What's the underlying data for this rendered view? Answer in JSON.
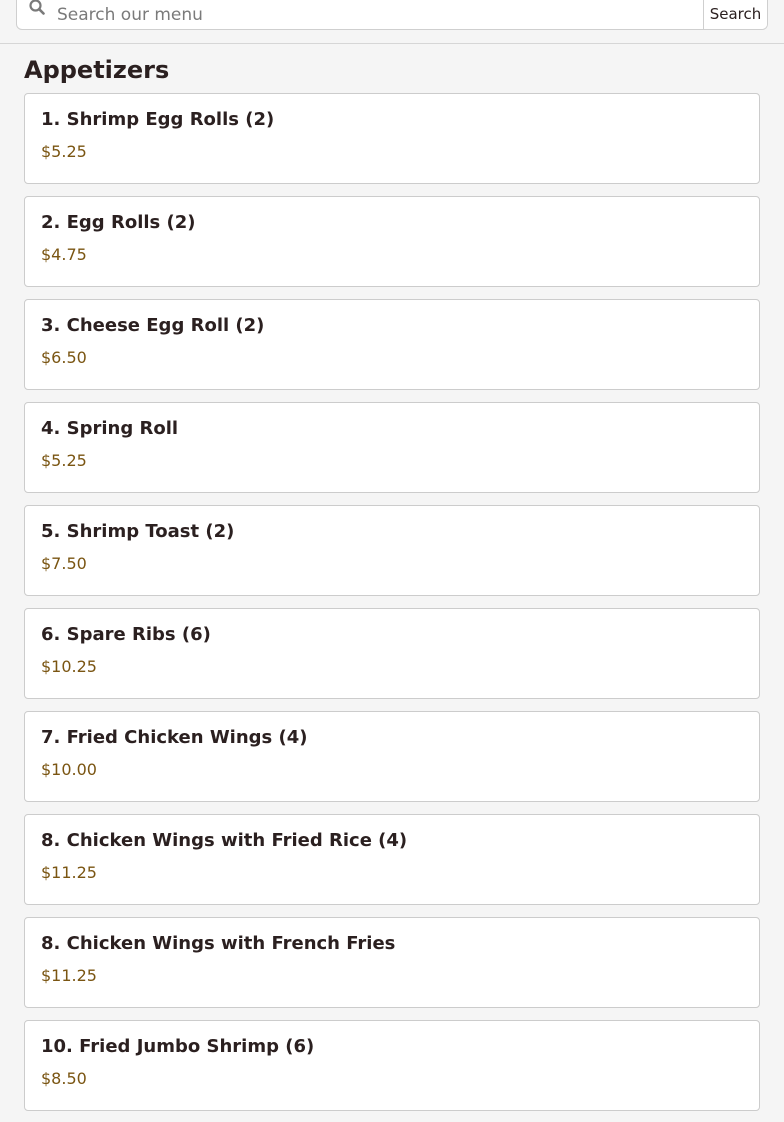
{
  "search": {
    "placeholder": "Search our menu",
    "button_label": "Search",
    "icon": "search-icon"
  },
  "section": {
    "title": "Appetizers"
  },
  "items": [
    {
      "name": "1. Shrimp Egg Rolls (2)",
      "price": "$5.25"
    },
    {
      "name": "2. Egg Rolls (2)",
      "price": "$4.75"
    },
    {
      "name": "3. Cheese Egg Roll (2)",
      "price": "$6.50"
    },
    {
      "name": "4. Spring Roll",
      "price": "$5.25"
    },
    {
      "name": "5. Shrimp Toast (2)",
      "price": "$7.50"
    },
    {
      "name": "6. Spare Ribs (6)",
      "price": "$10.25"
    },
    {
      "name": "7. Fried Chicken Wings (4)",
      "price": "$10.00"
    },
    {
      "name": "8. Chicken Wings with Fried Rice (4)",
      "price": "$11.25"
    },
    {
      "name": "8. Chicken Wings with French Fries",
      "price": "$11.25"
    },
    {
      "name": "10. Fried Jumbo Shrimp (6)",
      "price": "$8.50"
    }
  ],
  "colors": {
    "price": "#7a5512",
    "text": "#2b2020",
    "background": "#f5f5f5"
  }
}
